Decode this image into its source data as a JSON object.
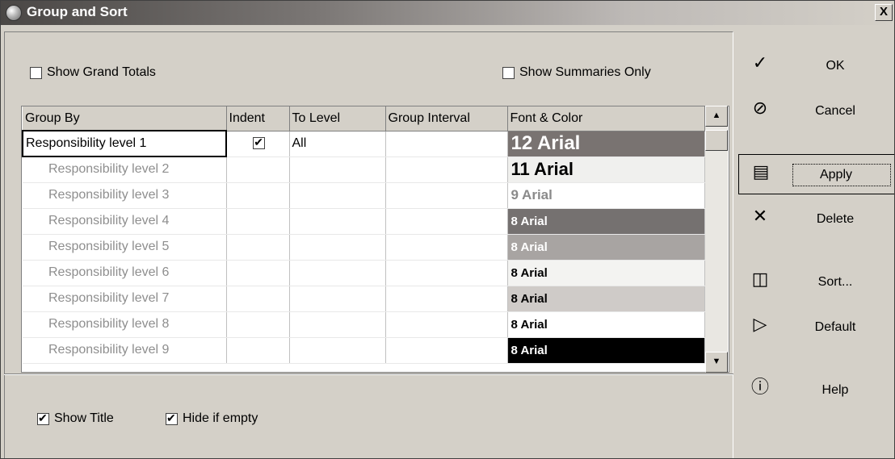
{
  "window": {
    "title": "Group and Sort",
    "close_label": "X"
  },
  "options": {
    "show_grand_totals": "Show Grand Totals",
    "show_summaries_only": "Show Summaries Only",
    "show_grand_totals_checked": false,
    "show_summaries_only_checked": false
  },
  "grid": {
    "columns": [
      "Group By",
      "Indent",
      "To Level",
      "Group Interval",
      "Font & Color"
    ],
    "rows": [
      {
        "group_by": "Responsibility level 1",
        "indent": true,
        "to_level": "All",
        "font": "12 Arial",
        "bg": "#797371",
        "fg": "#ffffff",
        "size": 24
      },
      {
        "group_by": "Responsibility level 2",
        "indent": false,
        "to_level": "",
        "font": "11 Arial",
        "bg": "#f0f0ee",
        "fg": "#000000",
        "size": 22
      },
      {
        "group_by": "Responsibility level 3",
        "indent": false,
        "to_level": "",
        "font": "9 Arial",
        "bg": "#ffffff",
        "fg": "#8a8a8a",
        "size": 17
      },
      {
        "group_by": "Responsibility level 4",
        "indent": false,
        "to_level": "",
        "font": "8 Arial",
        "bg": "#757170",
        "fg": "#ffffff",
        "size": 15
      },
      {
        "group_by": "Responsibility level 5",
        "indent": false,
        "to_level": "",
        "font": "8 Arial",
        "bg": "#a8a4a2",
        "fg": "#ffffff",
        "size": 15
      },
      {
        "group_by": "Responsibility level 6",
        "indent": false,
        "to_level": "",
        "font": "8 Arial",
        "bg": "#f3f3f1",
        "fg": "#000000",
        "size": 15
      },
      {
        "group_by": "Responsibility level 7",
        "indent": false,
        "to_level": "",
        "font": "8 Arial",
        "bg": "#cfcbc8",
        "fg": "#000000",
        "size": 15
      },
      {
        "group_by": "Responsibility level 8",
        "indent": false,
        "to_level": "",
        "font": "8 Arial",
        "bg": "#ffffff",
        "fg": "#000000",
        "size": 15
      },
      {
        "group_by": "Responsibility level 9",
        "indent": false,
        "to_level": "",
        "font": "8 Arial",
        "bg": "#000000",
        "fg": "#ffffff",
        "size": 15
      }
    ]
  },
  "footer": {
    "show_title": "Show Title",
    "hide_if_empty": "Hide if empty",
    "show_title_checked": true,
    "hide_if_empty_checked": true
  },
  "buttons": {
    "ok": "OK",
    "cancel": "Cancel",
    "apply": "Apply",
    "delete": "Delete",
    "sort": "Sort...",
    "default": "Default",
    "help": "Help"
  },
  "icons": {
    "ok": "checkmark-icon",
    "cancel": "no-entry-icon",
    "apply": "apply-icon",
    "delete": "x-icon",
    "sort": "sort-icon",
    "default": "play-triangle-icon",
    "help": "question-icon"
  }
}
